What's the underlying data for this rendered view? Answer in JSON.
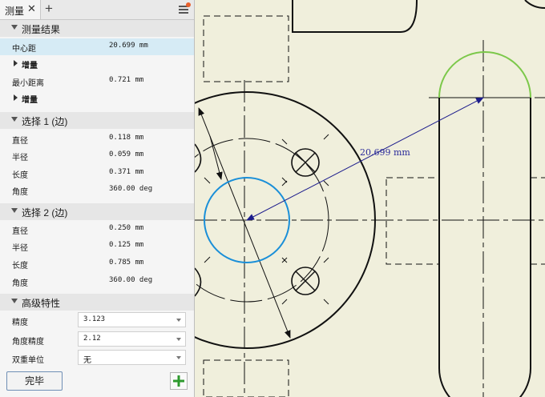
{
  "panel": {
    "tab_label": "测量",
    "tab_close": "✕",
    "tab_add": "+",
    "sections": {
      "results": "测量结果",
      "sel1": "选择 1 (边)",
      "sel2": "选择 2 (边)",
      "advanced": "高级特性"
    },
    "results": {
      "center_label": "中心距",
      "center_value": "20.699 mm",
      "delta1": "增量",
      "min_label": "最小距离",
      "min_value": "0.721 mm",
      "delta2": "增量"
    },
    "sel1": [
      {
        "label": "直径",
        "value": "0.118 mm"
      },
      {
        "label": "半径",
        "value": "0.059 mm"
      },
      {
        "label": "长度",
        "value": "0.371 mm"
      },
      {
        "label": "角度",
        "value": "360.00 deg"
      }
    ],
    "sel2": [
      {
        "label": "直径",
        "value": "0.250 mm"
      },
      {
        "label": "半径",
        "value": "0.125 mm"
      },
      {
        "label": "长度",
        "value": "0.785 mm"
      },
      {
        "label": "角度",
        "value": "360.00 deg"
      }
    ],
    "advanced": {
      "precision_label": "精度",
      "precision_value": "3.123",
      "angle_precision_label": "角度精度",
      "angle_precision_value": "2.12",
      "dual_unit_label": "双重单位",
      "dual_unit_value": "无"
    },
    "done_button": "完毕"
  },
  "canvas": {
    "dimension_label": "20.699 mm"
  },
  "colors": {
    "canvas_bg": "#f0efdc",
    "highlight_blue": "#1a8fd8",
    "highlight_green": "#7cc84a",
    "dimension_blue": "#1c1c8c",
    "selected_row": "#d6ebf5"
  }
}
